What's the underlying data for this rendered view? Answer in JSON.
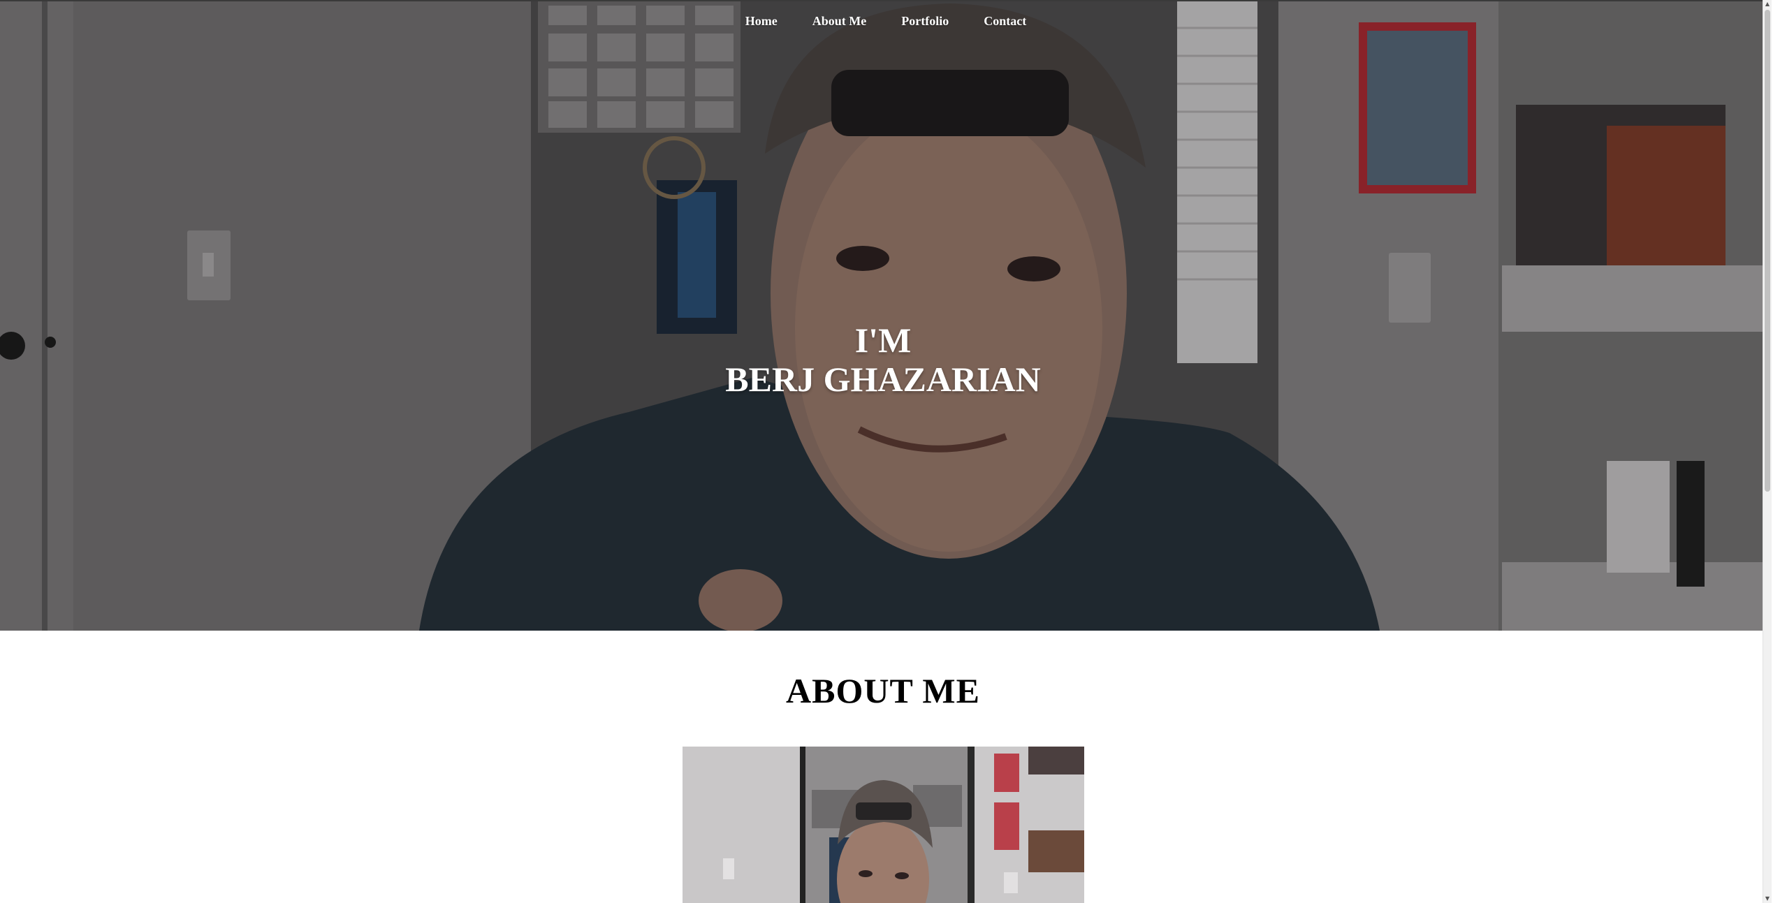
{
  "nav": {
    "items": [
      {
        "label": "Home"
      },
      {
        "label": "About Me"
      },
      {
        "label": "Portfolio"
      },
      {
        "label": "Contact"
      }
    ]
  },
  "hero": {
    "line1": "I'M",
    "line2": "BERJ GHAZARIAN"
  },
  "about": {
    "heading": "ABOUT ME"
  },
  "scrollbar": {
    "up_icon": "arrow-up-icon",
    "down_icon": "arrow-down-icon"
  },
  "colors": {
    "nav_text": "#ffffff",
    "hero_text": "#ffffff",
    "heading_text": "#000000",
    "page_background": "#ffffff"
  }
}
